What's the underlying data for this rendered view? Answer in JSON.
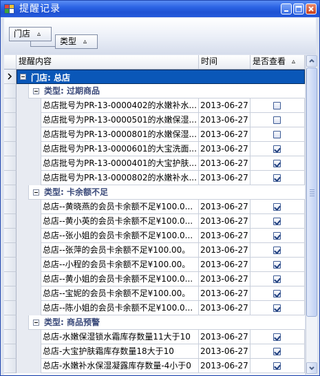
{
  "window": {
    "title": "提醒记录"
  },
  "group_panel": {
    "chips": [
      {
        "label": "门店",
        "sort": "▵"
      },
      {
        "label": "类型",
        "sort": "▵"
      }
    ]
  },
  "grid": {
    "columns": [
      {
        "label": "提醒内容",
        "sort": ""
      },
      {
        "label": "时间",
        "sort": ""
      },
      {
        "label": "是否查看",
        "sort": "▵"
      }
    ],
    "top_group": "门店: 总店",
    "groups": [
      {
        "label": "类型: 过期商品",
        "rows": [
          {
            "content": "总店批号为PR-13-0000402的水嫩补水...",
            "time": "2013-06-27",
            "viewed": false
          },
          {
            "content": "总店批号为PR-13-0000501的水嫩保湿...",
            "time": "2013-06-27",
            "viewed": false
          },
          {
            "content": "总店批号为PR-13-0000801的水嫩保湿...",
            "time": "2013-06-27",
            "viewed": false
          },
          {
            "content": "总店批号为PR-13-0000601的大宝洗面...",
            "time": "2013-06-27",
            "viewed": true
          },
          {
            "content": "总店批号为PR-13-0000401的大宝护肤...",
            "time": "2013-06-27",
            "viewed": true
          },
          {
            "content": "总店批号为PR-13-0000802的水嫩补水...",
            "time": "2013-06-27",
            "viewed": true
          }
        ]
      },
      {
        "label": "类型: 卡余额不足",
        "rows": [
          {
            "content": "总店--黄晓燕的会员卡余额不足¥100.0...",
            "time": "2013-06-27",
            "viewed": true
          },
          {
            "content": "总店--黄小英的会员卡余额不足¥100.0...",
            "time": "2013-06-27",
            "viewed": true
          },
          {
            "content": "总店--张小姐的会员卡余额不足¥100.0...",
            "time": "2013-06-27",
            "viewed": true
          },
          {
            "content": "总店--张萍的会员卡余额不足¥100.00。",
            "time": "2013-06-27",
            "viewed": true
          },
          {
            "content": "总店--小程的会员卡余额不足¥100.00。",
            "time": "2013-06-27",
            "viewed": true
          },
          {
            "content": "总店--黄小姐的会员卡余额不足¥100.0...",
            "time": "2013-06-27",
            "viewed": true
          },
          {
            "content": "总店--宝妮的会员卡余额不足¥100.00。",
            "time": "2013-06-27",
            "viewed": true
          },
          {
            "content": "总店--陈小姐的会员卡余额不足¥100.0...",
            "time": "2013-06-27",
            "viewed": true
          }
        ]
      },
      {
        "label": "类型: 商品预警",
        "rows": [
          {
            "content": "总店-水嫩保湿锁水霜库存数量11大于10",
            "time": "2013-06-27",
            "viewed": true
          },
          {
            "content": "总店-大宝护肤霜库存数量18大于10",
            "time": "2013-06-27",
            "viewed": true
          },
          {
            "content": "总店-水嫩补水保湿凝露库存数量-4小于0",
            "time": "2013-06-27",
            "viewed": true
          }
        ]
      }
    ]
  }
}
